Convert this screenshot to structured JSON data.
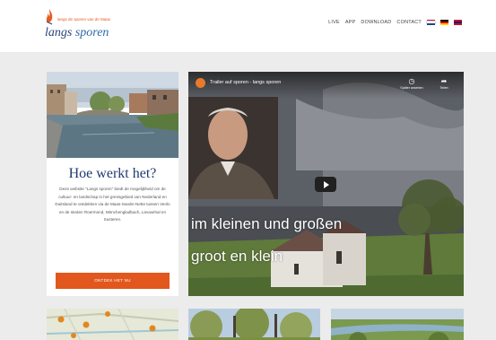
{
  "logo": {
    "tagline": "langs de sporen van de Maas",
    "name_first": "langs",
    "name_second": "sporen"
  },
  "nav": {
    "items": [
      "LIVE",
      "APP",
      "DOWNLOAD",
      "CONTACT"
    ]
  },
  "languages": [
    {
      "name": "nl-flag-icon",
      "colors": [
        "#c8102e",
        "#ffffff",
        "#21468b"
      ]
    },
    {
      "name": "de-flag-icon",
      "colors": [
        "#000000",
        "#dd0000",
        "#ffce00"
      ]
    },
    {
      "name": "gb-flag-icon",
      "colors": [
        "#c8102e",
        "#012169",
        "#c8102e"
      ]
    }
  ],
  "card": {
    "title": "Hoe werkt het?",
    "text": "Deze website \"Langs sporen\" biedt de mogelijkheid om de cultuur- en landschap in het grensgebied van Nederland en Duitsland te ontdekken via de Maas-Swalm-Nette tussen Venlo en de steden Roermond, Mönchengladbach, Lieuwehal en Susteren.",
    "button": "ONTDEK HET NU"
  },
  "video": {
    "title": "Trailer auf sporen - langs sporen",
    "watch_later": "Später ansehen",
    "share": "Teilen",
    "subtitle_line1": "im kleinen und großen",
    "subtitle_line2": "groot en klein"
  },
  "colors": {
    "accent": "#e2571d",
    "brand": "#1f3a70"
  }
}
